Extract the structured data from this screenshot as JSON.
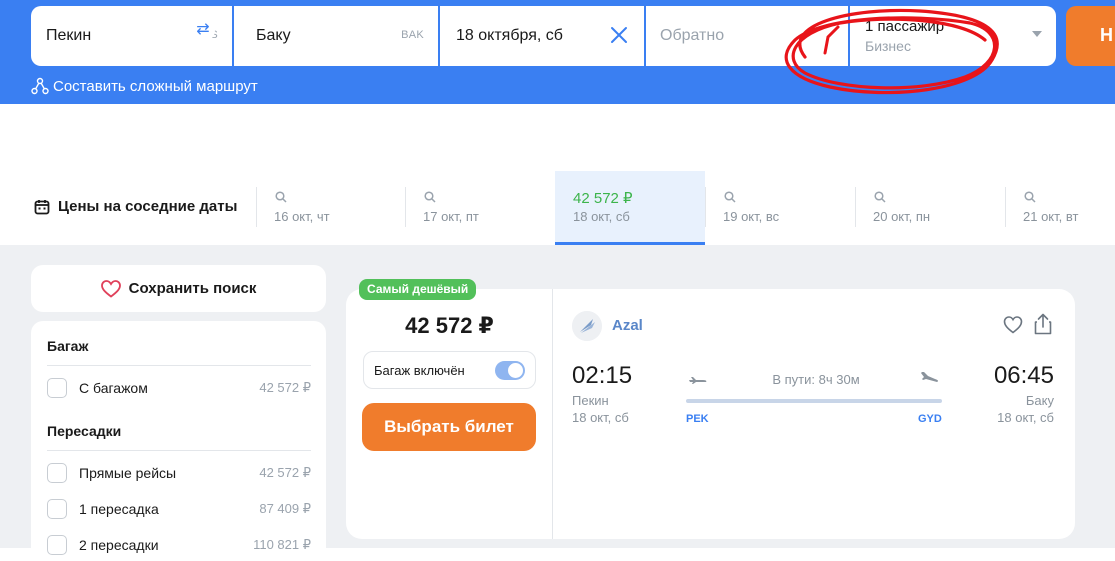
{
  "search": {
    "from_city": "Пекин",
    "from_iata": "BJS",
    "to_city": "Баку",
    "to_iata": "BAK",
    "date": "18 октября, сб",
    "return_placeholder": "Обратно",
    "passengers": "1 пассажир",
    "cabin_class": "Бизнес",
    "find_label": "Н",
    "complex_route": "Составить сложный маршрут"
  },
  "nearby": {
    "title": "Цены на соседние даты",
    "dates": [
      {
        "label": "16 окт, чт",
        "price": ""
      },
      {
        "label": "17 окт, пт",
        "price": ""
      },
      {
        "label": "18 окт, сб",
        "price": "42 572 ₽"
      },
      {
        "label": "19 окт, вс",
        "price": ""
      },
      {
        "label": "20 окт, пн",
        "price": ""
      },
      {
        "label": "21 окт, вт",
        "price": ""
      }
    ],
    "active_index": 2
  },
  "sidebar": {
    "save_search": "Сохранить поиск",
    "baggage_title": "Багаж",
    "baggage_items": [
      {
        "label": "С багажом",
        "price": "42 572 ₽"
      }
    ],
    "stops_title": "Пересадки",
    "stops_items": [
      {
        "label": "Прямые рейсы",
        "price": "42 572 ₽"
      },
      {
        "label": "1 пересадка",
        "price": "87 409 ₽"
      },
      {
        "label": "2 пересадки",
        "price": "110 821 ₽"
      }
    ]
  },
  "ticket": {
    "badge": "Самый дешёвый",
    "price": "42 572 ₽",
    "baggage_label": "Багаж включён",
    "baggage_included": true,
    "buy_label": "Выбрать билет",
    "airline": "Azal",
    "departure_time": "02:15",
    "arrival_time": "06:45",
    "departure_city": "Пекин",
    "arrival_city": "Баку",
    "departure_date": "18 окт, сб",
    "arrival_date": "18 окт, сб",
    "duration": "В пути: 8ч 30м",
    "departure_iata": "PEK",
    "arrival_iata": "GYD"
  },
  "colors": {
    "brand_blue": "#3a7ff2",
    "accent_orange": "#f07c2c",
    "price_green": "#3cb44b",
    "annotation_red": "#e8141a"
  }
}
